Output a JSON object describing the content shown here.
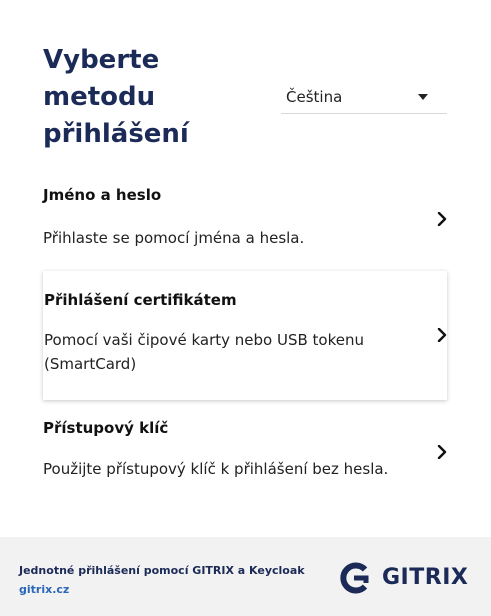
{
  "header": {
    "title": "Vyberte metodu přihlášení",
    "language": {
      "selected": "Čeština",
      "icon": "caret-down-icon"
    }
  },
  "methods": [
    {
      "title": "Jméno a heslo",
      "description": "Přihlaste se pomocí jména a hesla.",
      "icon": "chevron-right-icon"
    },
    {
      "title": "Přihlášení certifikátem",
      "description": "Pomocí vaši čipové karty nebo USB tokenu (SmartCard)",
      "icon": "chevron-right-icon"
    },
    {
      "title": "Přístupový klíč",
      "description": "Použijte přístupový klíč k přihlášení bez hesla.",
      "icon": "chevron-right-icon"
    }
  ],
  "footer": {
    "text": "Jednotné přihlášení pomocí GITRIX a Keycloak",
    "link": "gitrix.cz",
    "logo_text": "GITRIX"
  },
  "colors": {
    "brand_navy": "#1b2a57",
    "link_blue": "#2a67b8",
    "footer_bg": "#f2f2f2"
  }
}
